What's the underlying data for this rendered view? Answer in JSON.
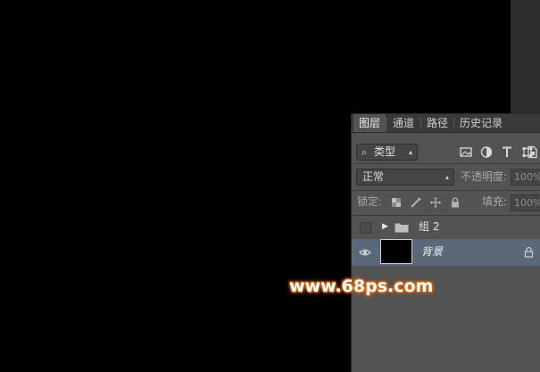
{
  "panel": {
    "tabs": [
      {
        "label": "图层",
        "active": true
      },
      {
        "label": "通道",
        "active": false
      },
      {
        "label": "路径",
        "active": false
      },
      {
        "label": "历史记录",
        "active": false
      }
    ],
    "filter": {
      "kind_label": "类型",
      "icons": [
        "image-filter-icon",
        "adjustment-filter-icon",
        "type-filter-icon",
        "shape-filter-icon",
        "smart-object-filter-icon"
      ]
    },
    "blend_mode": "正常",
    "opacity_label": "不透明度:",
    "opacity_value": "100%",
    "lock_label": "锁定:",
    "fill_label": "填充:",
    "fill_value": "100%",
    "layers": [
      {
        "name": "组 2",
        "type": "group",
        "visible": false,
        "expanded": false
      },
      {
        "name": "背景",
        "type": "background",
        "visible": true,
        "selected": true,
        "locked": true
      }
    ]
  },
  "watermark": "www.68ps.com",
  "colors": {
    "canvas": "#000000",
    "panel": "#535353",
    "selected_layer": "#5b6877",
    "watermark_glow": "#e07a2a"
  }
}
